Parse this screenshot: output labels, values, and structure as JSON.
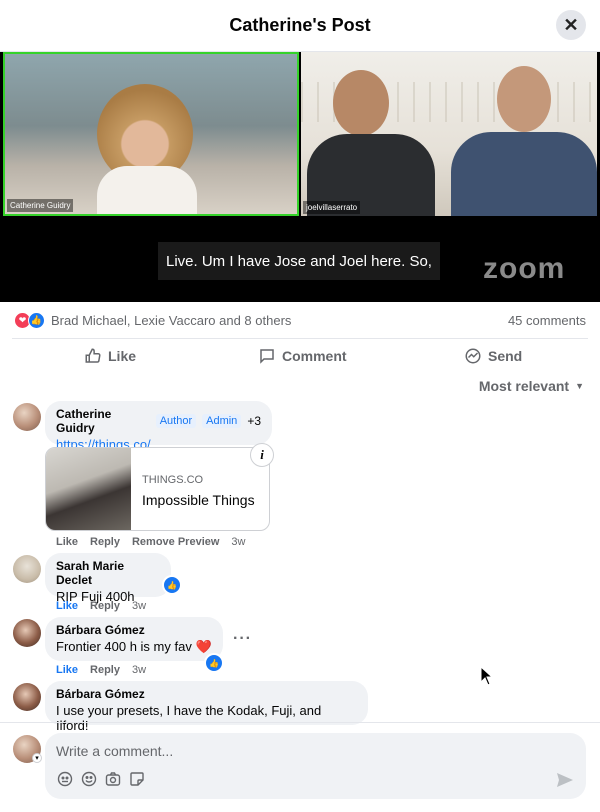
{
  "header": {
    "title": "Catherine's Post",
    "close_icon": "close-icon"
  },
  "video": {
    "left_name": "Catherine Guidry",
    "right_name": "joelvillaserrato",
    "caption": "Live. Um I have Jose and Joel here. So,",
    "logo": "zoom"
  },
  "reactions": {
    "text": "Brad Michael, Lexie Vaccaro and 8 others",
    "comments": "45 comments"
  },
  "actions": {
    "like": "Like",
    "comment": "Comment",
    "send": "Send"
  },
  "sort": {
    "label": "Most relevant"
  },
  "comments": [
    {
      "name": "Catherine Guidry",
      "badge_author": "Author",
      "badge_admin": "Admin",
      "extra": "+3",
      "link": "https://things.co/",
      "preview": {
        "domain": "THINGS.CO",
        "title": "Impossible Things"
      },
      "like": "Like",
      "reply": "Reply",
      "remove": "Remove Preview",
      "time": "3w"
    },
    {
      "name": "Sarah Marie Declet",
      "text": "RIP Fuji 400h",
      "like": "Like",
      "reply": "Reply",
      "time": "3w"
    },
    {
      "name": "Bárbara Gómez",
      "text": "Frontier 400 h is my fav ❤️",
      "like": "Like",
      "reply": "Reply",
      "time": "3w"
    },
    {
      "name": "Bárbara Gómez",
      "text": "I use your presets, I have the Kodak, Fuji, and Ilford!"
    }
  ],
  "composer": {
    "placeholder": "Write a comment..."
  },
  "colors": {
    "accent": "#1877f2",
    "love": "#f33e58",
    "active_speaker": "#35d32a"
  }
}
